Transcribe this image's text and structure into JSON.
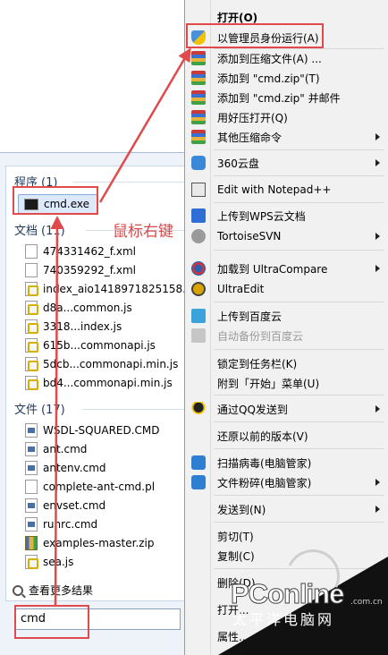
{
  "search": {
    "query": "cmd",
    "see_more": "查看更多结果"
  },
  "categories": {
    "programs": {
      "label": "程序",
      "count": "(1)"
    },
    "documents": {
      "label": "文档",
      "count": "(11)"
    },
    "files": {
      "label": "文件",
      "count": "(17)"
    }
  },
  "programs": [
    {
      "name": "cmd.exe",
      "icon": "cmd-exe-icon"
    }
  ],
  "documents": [
    {
      "name": "474331462_f.xml",
      "icon": "xml-file-icon"
    },
    {
      "name": "740359292_f.xml",
      "icon": "xml-file-icon"
    },
    {
      "name": "index_aio1418971825158.js",
      "icon": "js-file-icon"
    },
    {
      "name": "d8a...common.js",
      "icon": "js-file-icon"
    },
    {
      "name": "3318...index.js",
      "icon": "js-file-icon"
    },
    {
      "name": "615b...commonapi.js",
      "icon": "js-file-icon"
    },
    {
      "name": "5dcb...commonapi.min.js",
      "icon": "js-file-icon"
    },
    {
      "name": "bd4...commonapi.min.js",
      "icon": "js-file-icon"
    }
  ],
  "files": [
    {
      "name": "WSDL-SQUARED.CMD",
      "icon": "cmd-file-icon"
    },
    {
      "name": "ant.cmd",
      "icon": "cmd-file-icon"
    },
    {
      "name": "antenv.cmd",
      "icon": "cmd-file-icon"
    },
    {
      "name": "complete-ant-cmd.pl",
      "icon": "pl-file-icon"
    },
    {
      "name": "envset.cmd",
      "icon": "cmd-file-icon"
    },
    {
      "name": "runrc.cmd",
      "icon": "cmd-file-icon"
    },
    {
      "name": "examples-master.zip",
      "icon": "zip-file-icon"
    },
    {
      "name": "sea.js",
      "icon": "js-file-icon"
    }
  ],
  "annotation": {
    "text": "鼠标右键",
    "color": "#d94a4a"
  },
  "context_menu": {
    "items": [
      {
        "label": "打开(O)",
        "bold": true
      },
      {
        "label": "以管理员身份运行(A)",
        "icon": "uac-shield-icon"
      },
      {
        "label": "添加到压缩文件(A) ...",
        "icon": "winrar-icon"
      },
      {
        "label": "添加到 \"cmd.zip\"(T)",
        "icon": "winrar-icon"
      },
      {
        "label": "添加到 \"cmd.zip\" 并邮件",
        "icon": "winrar-icon"
      },
      {
        "label": "用好压打开(Q)",
        "icon": "haozip-icon"
      },
      {
        "label": "其他压缩命令",
        "icon": "winrar-icon",
        "submenu": true
      },
      {
        "label": "360云盘",
        "icon": "cloud-360-icon",
        "submenu": true
      },
      {
        "label": "Edit with Notepad++",
        "icon": "notepad-icon"
      },
      {
        "label": "上传到WPS云文档",
        "icon": "wps-icon"
      },
      {
        "label": "TortoiseSVN",
        "icon": "tortoise-svn-icon",
        "submenu": true
      },
      {
        "label": "加载到 UltraCompare",
        "icon": "ultracompare-icon",
        "submenu": true
      },
      {
        "label": "UltraEdit",
        "icon": "ultraedit-icon"
      },
      {
        "label": "上传到百度云",
        "icon": "baidu-cloud-icon"
      },
      {
        "label": "自动备份到百度云",
        "icon": "baidu-cloud-icon",
        "disabled": true
      },
      {
        "label": "锁定到任务栏(K)"
      },
      {
        "label": "附到「开始」菜单(U)"
      },
      {
        "label": "通过QQ发送到",
        "icon": "qq-icon",
        "submenu": true
      },
      {
        "label": "还原以前的版本(V)"
      },
      {
        "label": "扫描病毒(电脑管家)",
        "icon": "tencent-pc-manager-icon"
      },
      {
        "label": "文件粉碎(电脑管家)",
        "icon": "tencent-pc-manager-icon",
        "submenu": true
      },
      {
        "label": "发送到(N)",
        "submenu": true
      },
      {
        "label": "剪切(T)"
      },
      {
        "label": "复制(C)"
      },
      {
        "label": "删除(D)"
      },
      {
        "label": "打开..."
      },
      {
        "label": "属性..."
      }
    ]
  },
  "watermark": {
    "brand": "PConline",
    "domain": ".com.cn",
    "subtitle": "太平洋电脑网"
  }
}
